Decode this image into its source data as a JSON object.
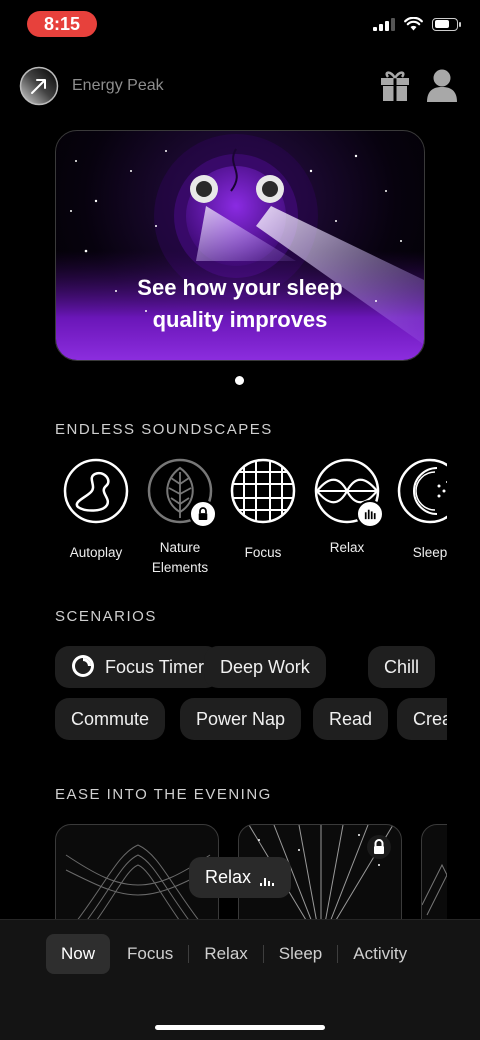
{
  "status": {
    "time": "8:15"
  },
  "header": {
    "title": "Energy Peak",
    "icon": "arrow-up-right-icon"
  },
  "hero": {
    "line1": "See how your sleep",
    "line2": "quality improves"
  },
  "sections": {
    "soundscapes": "ENDLESS SOUNDSCAPES",
    "scenarios": "SCENARIOS",
    "evening": "EASE INTO THE EVENING"
  },
  "soundscapes": [
    {
      "line1": "Autoplay",
      "line2": ""
    },
    {
      "line1": "Nature",
      "line2": "Elements"
    },
    {
      "line1": "Focus",
      "line2": ""
    },
    {
      "line1": "Relax",
      "line2": ""
    },
    {
      "line1": "Sleep",
      "line2": ""
    }
  ],
  "scenarios_row1": [
    "Focus Timer",
    "Deep Work",
    "Chill"
  ],
  "scenarios_row2": [
    "Commute",
    "Power Nap",
    "Read",
    "Create"
  ],
  "now_playing": {
    "label": "Relax"
  },
  "tabs": [
    "Now",
    "Focus",
    "Relax",
    "Sleep",
    "Activity"
  ],
  "colors": {
    "time_pill": "#e7413c",
    "hero_purple": "#7a17c9"
  }
}
